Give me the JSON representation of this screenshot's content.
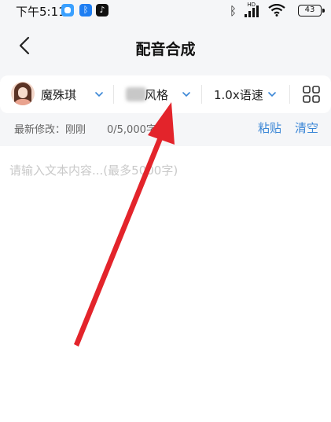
{
  "status_bar": {
    "time": "下午5:11",
    "battery": "43",
    "network_label": "HD"
  },
  "header": {
    "title": "配音合成"
  },
  "toolbar": {
    "voice_name": "魔殊琪",
    "style_label": "风格",
    "speed_label": "1.0x语速"
  },
  "meta": {
    "modified_label": "最新修改：刚刚",
    "char_count": "0/5,000字",
    "paste_label": "粘贴",
    "clear_label": "清空"
  },
  "editor": {
    "placeholder": "请输入文本内容...(最多5000字)",
    "value": ""
  },
  "colors": {
    "accent": "#3a86d6",
    "annotation": "#e3242b",
    "background": "#f5f6f8"
  }
}
